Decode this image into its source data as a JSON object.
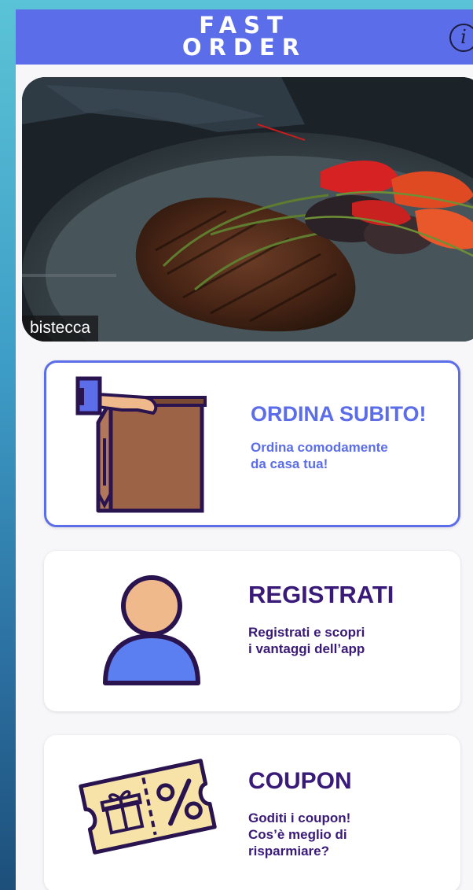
{
  "header": {
    "title": "FAST\nORDER",
    "info_icon": "info-icon",
    "info_glyph": "i"
  },
  "hero": {
    "caption": "bistecca",
    "image": "grilled-steak-photo"
  },
  "cards": [
    {
      "title": "ORDINA SUBITO!",
      "subtitle": "Ordina comodamente\nda casa tua!",
      "icon": "takeaway-bag-icon",
      "title_color": "#5b6de8",
      "subtitle_color": "#5b6de8"
    },
    {
      "title": "REGISTRATI",
      "subtitle": "Registrati e scopri\ni vantaggi dell’app",
      "icon": "user-icon",
      "title_color": "#3a1a78",
      "subtitle_color": "#3a1a78"
    },
    {
      "title": "COUPON",
      "subtitle": "Goditi i coupon!\nCos’è meglio di\nrisparmiare?",
      "icon": "coupon-icon",
      "title_color": "#3a1a78",
      "subtitle_color": "#3a1a78"
    }
  ],
  "colors": {
    "accent": "#5b6de8",
    "dark_purple": "#3a1a78",
    "bag_brown": "#9c6347",
    "skin": "#f0b98b",
    "coupon_yellow": "#f7e3a8"
  }
}
